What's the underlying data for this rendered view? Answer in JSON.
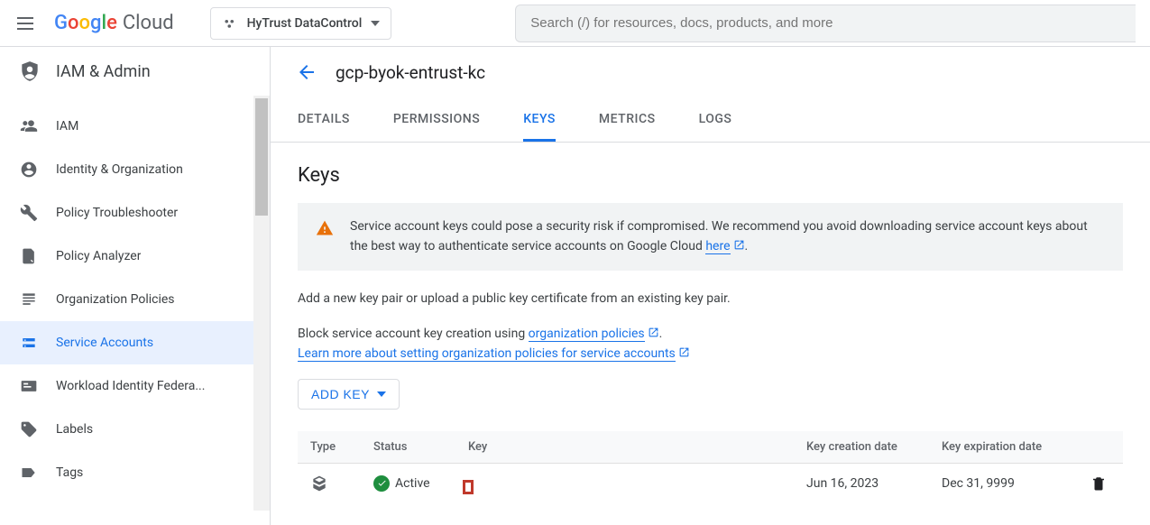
{
  "brand": {
    "name": "Google",
    "product": "Cloud"
  },
  "project": {
    "name": "HyTrust DataControl"
  },
  "search": {
    "placeholder": "Search (/) for resources, docs, products, and more"
  },
  "section": {
    "title": "IAM & Admin"
  },
  "sidebar": {
    "items": [
      {
        "label": "IAM"
      },
      {
        "label": "Identity & Organization"
      },
      {
        "label": "Policy Troubleshooter"
      },
      {
        "label": "Policy Analyzer"
      },
      {
        "label": "Organization Policies"
      },
      {
        "label": "Service Accounts"
      },
      {
        "label": "Workload Identity Federa..."
      },
      {
        "label": "Labels"
      },
      {
        "label": "Tags"
      }
    ]
  },
  "page": {
    "title": "gcp-byok-entrust-kc"
  },
  "tabs": [
    {
      "label": "DETAILS"
    },
    {
      "label": "PERMISSIONS"
    },
    {
      "label": "KEYS"
    },
    {
      "label": "METRICS"
    },
    {
      "label": "LOGS"
    }
  ],
  "keys_section": {
    "heading": "Keys",
    "alert_part1": "Service account keys could pose a security risk if compromised. We recommend you avoid downloading service account keys",
    "alert_part2": "about the best way to authenticate service accounts on Google Cloud ",
    "alert_link": "here",
    "add_text": "Add a new key pair or upload a public key certificate from an existing key pair.",
    "block_prefix": "Block service account key creation using ",
    "block_link": "organization policies",
    "learn_link": "Learn more about setting organization policies for service accounts",
    "add_button": "ADD KEY",
    "table": {
      "headers": {
        "type": "Type",
        "status": "Status",
        "key": "Key",
        "created": "Key creation date",
        "expires": "Key expiration date"
      },
      "rows": [
        {
          "status": "Active",
          "key": "[redacted]",
          "created": "Jun 16, 2023",
          "expires": "Dec 31, 9999"
        }
      ]
    }
  }
}
